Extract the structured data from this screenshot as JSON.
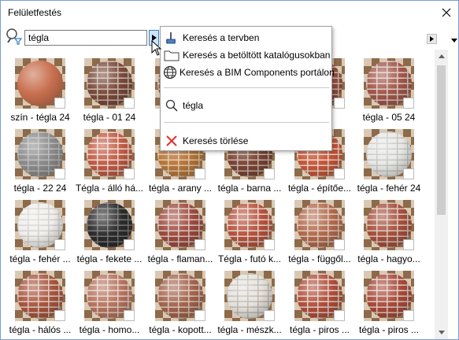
{
  "window": {
    "title": "Felületfestés"
  },
  "search": {
    "value": "tégla"
  },
  "popup": {
    "items": [
      {
        "label": "Keresés a tervben",
        "icon": "brush-icon"
      },
      {
        "label": "Keresés a betöltött katalógusokban",
        "icon": "folder-icon"
      },
      {
        "label": "Keresés a BIM Components portálon",
        "icon": "globe-icon"
      },
      {
        "label": "tégla",
        "icon": "search-icon"
      },
      {
        "label": "Keresés törlése",
        "icon": "clear-x-icon"
      }
    ]
  },
  "tiles": [
    {
      "label": "szín - tégla 24",
      "base": "#c8704f",
      "mortar": "none"
    },
    {
      "label": "tégla - 01 24",
      "base": "#7a4a3a",
      "mortar": "#c9b8ad"
    },
    {
      "label": "",
      "base": "#8e5a4c",
      "mortar": "#d2c6bd"
    },
    {
      "label": "",
      "base": "#a55c47",
      "mortar": "#d8cbc0"
    },
    {
      "label": "24",
      "base": "#9a5040",
      "mortar": "#d2c2b6"
    },
    {
      "label": "tégla - 05 24",
      "base": "#a3574b",
      "mortar": "#d9cbc2"
    },
    {
      "label": "tégla - 22 24",
      "base": "#8b8b8b",
      "mortar": "#b8b8b8"
    },
    {
      "label": "Tégla - álló há...",
      "base": "#c45a44",
      "mortar": "#e6ddd2"
    },
    {
      "label": "tégla - arany ...",
      "base": "#b9773c",
      "mortar": "#e0c9a8"
    },
    {
      "label": "tégla - barna ...",
      "base": "#7b4536",
      "mortar": "#c7b4a7"
    },
    {
      "label": "tégla - építőe...",
      "base": "#c9573b",
      "mortar": "#e8d7c9"
    },
    {
      "label": "tégla - fehér 24",
      "base": "#e8e8e6",
      "mortar": "#c4c4c0"
    },
    {
      "label": "tégla - fehér ...",
      "base": "#f0efec",
      "mortar": "#d0cfca"
    },
    {
      "label": "tégla - fekete ...",
      "base": "#2c2c2c",
      "mortar": "#777777"
    },
    {
      "label": "tégla - flaman...",
      "base": "#9e4a3f",
      "mortar": "#d8c7bd"
    },
    {
      "label": "Tégla - futó k...",
      "base": "#b8533f",
      "mortar": "#e4d6ca"
    },
    {
      "label": "tégla - függől...",
      "base": "#b36a4e",
      "mortar": "#ddcbbb"
    },
    {
      "label": "tégla - hagyo...",
      "base": "#a6503e",
      "mortar": "#d9c7ba"
    },
    {
      "label": "tégla - hálós ...",
      "base": "#a9553f",
      "mortar": "#dccbbd"
    },
    {
      "label": "tégla - homo...",
      "base": "#b87360",
      "mortar": "#e1d2c4"
    },
    {
      "label": "tégla - kopott...",
      "base": "#a4644f",
      "mortar": "#d7c6b7"
    },
    {
      "label": "tégla - mészk...",
      "base": "#e6e3de",
      "mortar": "#bcb8b0"
    },
    {
      "label": "tégla - piros ...",
      "base": "#b14e3c",
      "mortar": "#e0d2c6"
    },
    {
      "label": "tégla - piros ...",
      "base": "#a9493b",
      "mortar": "#dccbbf"
    }
  ]
}
